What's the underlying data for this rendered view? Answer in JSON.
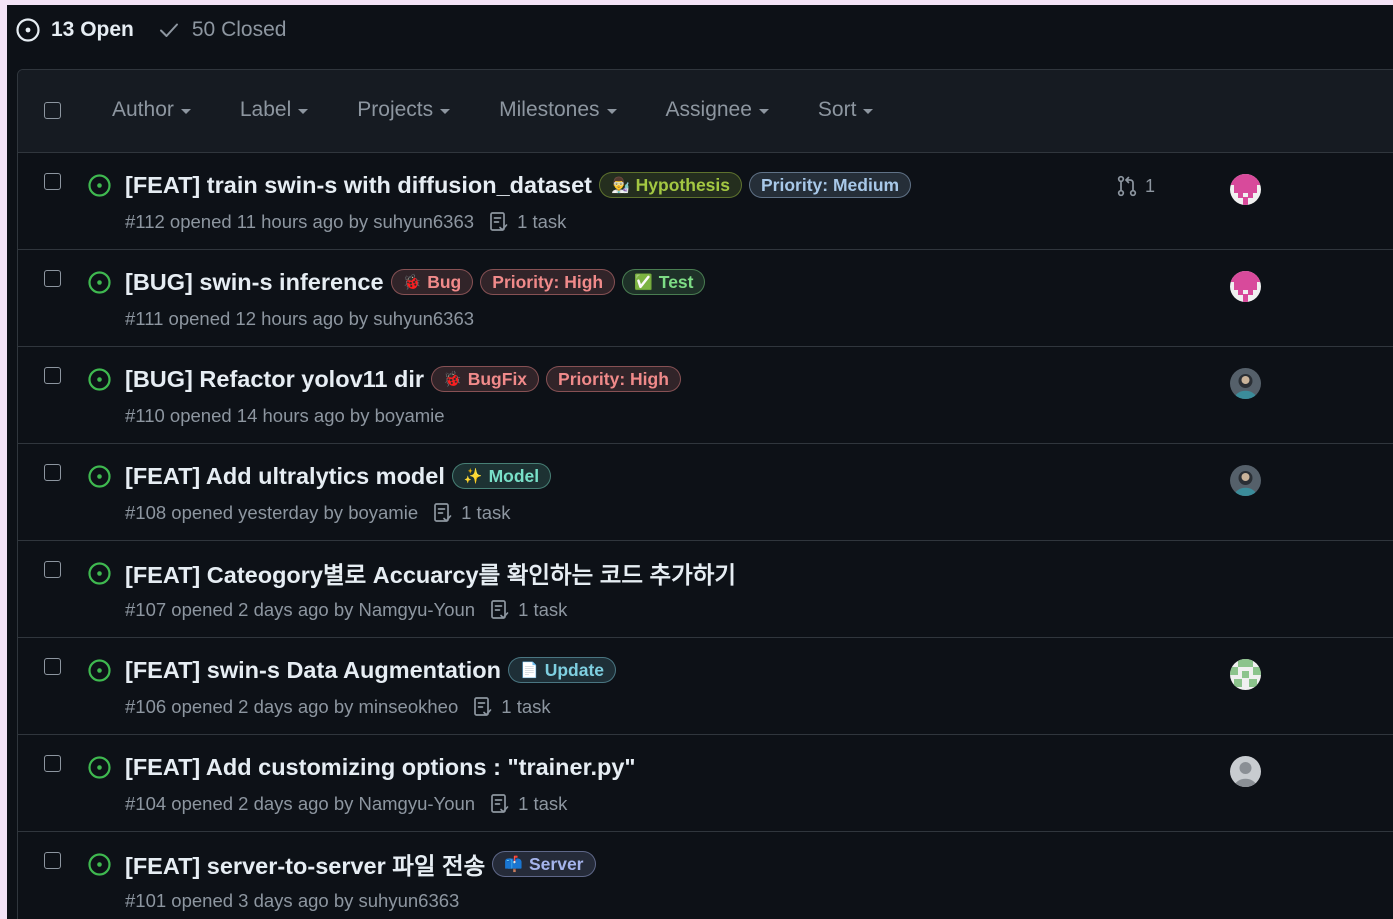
{
  "states": {
    "open_label": "13 Open",
    "closed_label": "50 Closed"
  },
  "filters": [
    "Author",
    "Label",
    "Projects",
    "Milestones",
    "Assignee",
    "Sort"
  ],
  "issues": [
    {
      "title": "[FEAT] train swin-s with diffusion_dataset",
      "labels": [
        {
          "icon": "👨‍🔬",
          "text": "Hypothesis",
          "color": "#a3c742"
        },
        {
          "icon": "",
          "text": "Priority: Medium",
          "color": "#a8c8e8"
        }
      ],
      "meta": "#112 opened 11 hours ago by suhyun6363",
      "task": "1 task",
      "pr_count": "1",
      "avatar": "pink"
    },
    {
      "title": "[BUG] swin-s inference",
      "labels": [
        {
          "icon": "🐞",
          "text": "Bug",
          "color": "#f08a8a"
        },
        {
          "icon": "",
          "text": "Priority: High",
          "color": "#f08a8a"
        },
        {
          "icon": "✅",
          "text": "Test",
          "color": "#7ddc85"
        }
      ],
      "meta": "#111 opened 12 hours ago by suhyun6363",
      "task": "",
      "pr_count": "",
      "avatar": "pink"
    },
    {
      "title": "[BUG] Refactor yolov11 dir",
      "labels": [
        {
          "icon": "🐞",
          "text": "BugFix",
          "color": "#f08a8a"
        },
        {
          "icon": "",
          "text": "Priority: High",
          "color": "#f08a8a"
        }
      ],
      "meta": "#110 opened 14 hours ago by boyamie",
      "task": "",
      "pr_count": "",
      "avatar": "photo"
    },
    {
      "title": "[FEAT] Add ultralytics model",
      "labels": [
        {
          "icon": "✨",
          "text": "Model",
          "color": "#79e0c8"
        }
      ],
      "meta": "#108 opened yesterday by boyamie",
      "task": "1 task",
      "pr_count": "",
      "avatar": "photo"
    },
    {
      "title": "[FEAT] Cateogory별로 Accuarcy를 확인하는 코드 추가하기",
      "labels": [],
      "meta": "#107 opened 2 days ago by Namgyu-Youn",
      "task": "1 task",
      "pr_count": "",
      "avatar": ""
    },
    {
      "title": "[FEAT] swin-s Data Augmentation",
      "labels": [
        {
          "icon": "📄",
          "text": "Update",
          "color": "#7ecfe0"
        }
      ],
      "meta": "#106 opened 2 days ago by minseokheo",
      "task": "1 task",
      "pr_count": "",
      "avatar": "green"
    },
    {
      "title": "[FEAT] Add customizing options : \"trainer.py\"",
      "labels": [],
      "meta": "#104 opened 2 days ago by Namgyu-Youn",
      "task": "1 task",
      "pr_count": "",
      "avatar": "grey"
    },
    {
      "title": "[FEAT] server-to-server 파일 전송",
      "labels": [
        {
          "icon": "📫",
          "text": "Server",
          "color": "#a5b4ec"
        }
      ],
      "meta": "#101 opened 3 days ago by suhyun6363",
      "task": "",
      "pr_count": "",
      "avatar": ""
    }
  ],
  "colors": {
    "background": "#0d1117",
    "header": "#161b22",
    "border": "#30363d",
    "open_green": "#3fb950",
    "muted": "#8d96a0"
  }
}
